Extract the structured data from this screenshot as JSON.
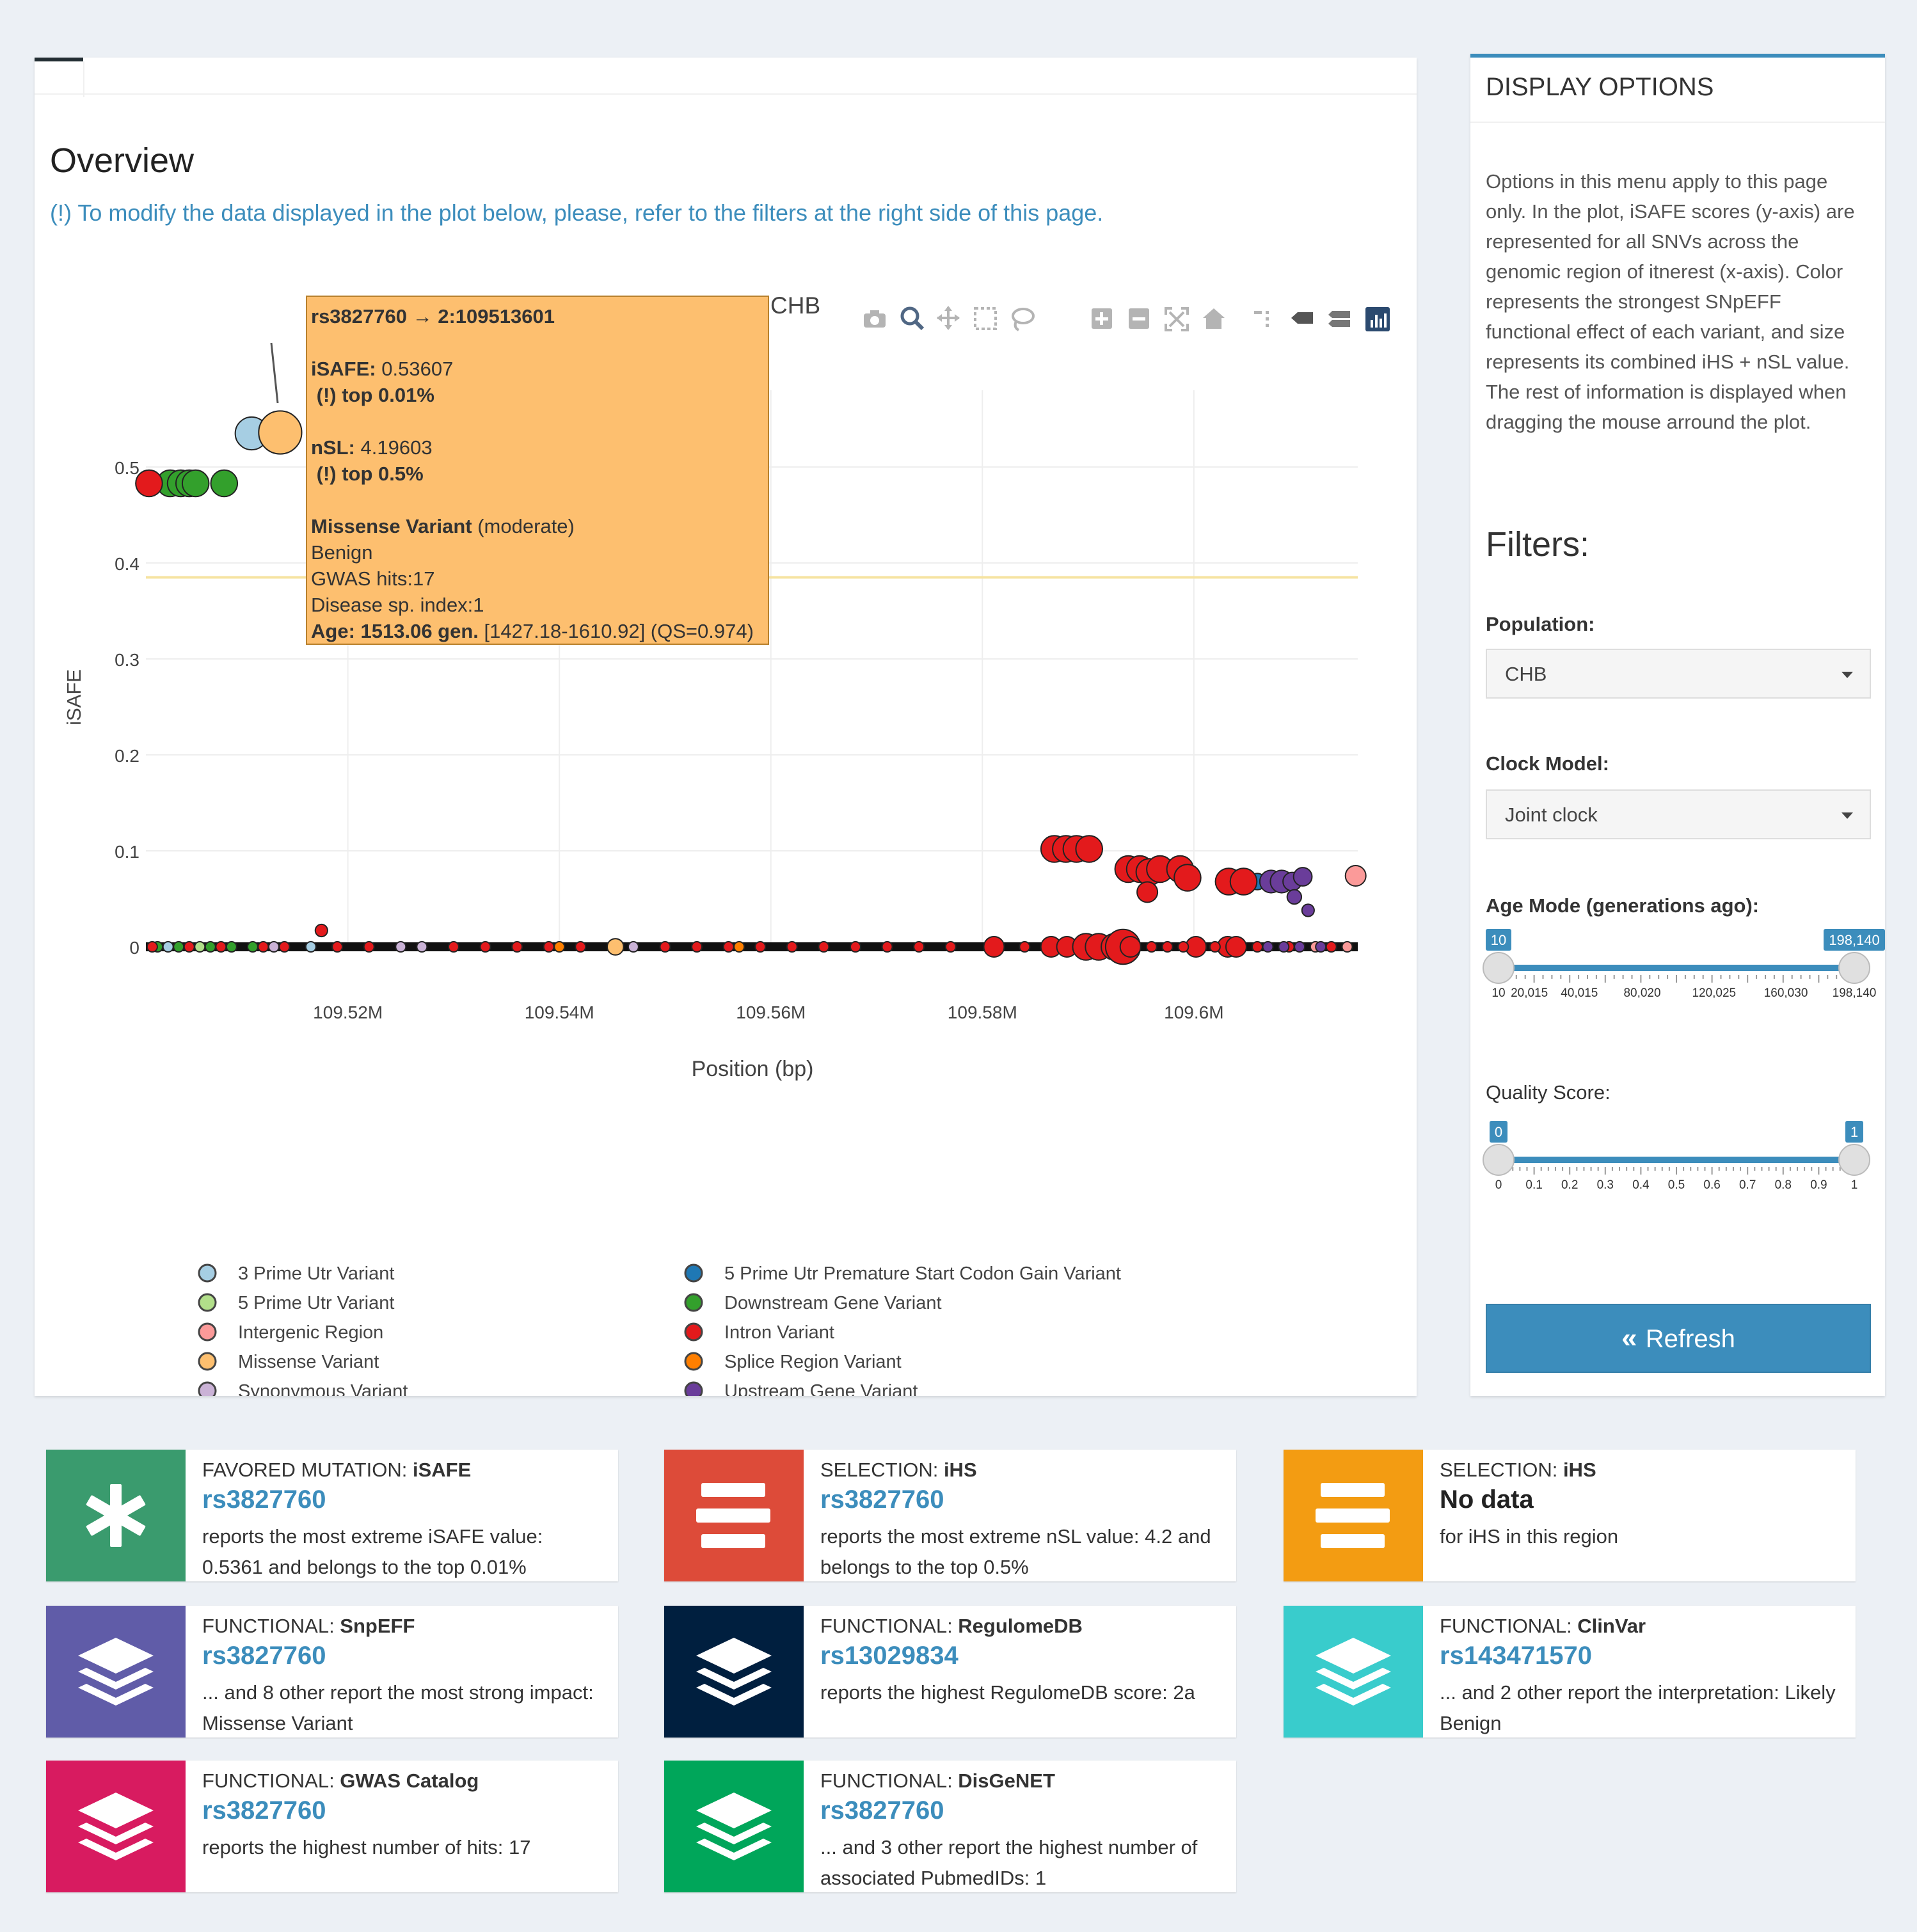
{
  "overview": {
    "title": "Overview",
    "note": "(!) To modify the data displayed in the plot below, please, refer to the filters at the right side of this page."
  },
  "plot": {
    "title_fragment": "CHB",
    "toolbar": [
      "camera-icon",
      "zoom-icon",
      "pan-icon",
      "box-select-icon",
      "lasso-select-icon",
      "zoom-in-icon",
      "zoom-out-icon",
      "autoscale-icon",
      "reset-axes-icon",
      "spike-lines-icon",
      "hover-closest-icon",
      "hover-compare-icon",
      "plotly-logo-icon"
    ],
    "tooltip": {
      "id_line": "rs3827760 → 2:109513601",
      "isafe_label": "iSAFE:",
      "isafe_value": "0.53607",
      "isafe_top": "(!) top 0.01%",
      "nsl_label": "nSL:",
      "nsl_value": "4.19603",
      "nsl_top": "(!) top 0.5%",
      "effect_label": "Missense Variant",
      "effect_impact": "(moderate)",
      "clinvar": "Benign",
      "gwas": "GWAS hits:17",
      "disease": "Disease sp. index:1",
      "age_label": "Age: 1513.06 gen.",
      "age_range": "[1427.18-1610.92] (QS=0.974)"
    }
  },
  "chart_data": {
    "type": "scatter",
    "title": "",
    "xlabel": "Position (bp)",
    "ylabel": "iSAFE",
    "xlim": [
      109500900,
      109615500
    ],
    "ylim": [
      0,
      0.58
    ],
    "x_ticks": [
      109520000,
      109540000,
      109560000,
      109580000,
      109600000
    ],
    "x_tick_labels": [
      "109.52M",
      "109.54M",
      "109.56M",
      "109.58M",
      "109.6M"
    ],
    "y_ticks": [
      0,
      0.1,
      0.2,
      0.3,
      0.4,
      0.5
    ],
    "y_tick_labels": [
      "0",
      "0.1",
      "0.2",
      "0.3",
      "0.4",
      "0.5"
    ],
    "threshold_line": 0.385,
    "grid": true,
    "legend_placement": "bottom",
    "series": [
      {
        "name": "3 Prime Utr Variant",
        "color": "#a6cee3",
        "points": [
          [
            109510900,
            0.535,
            3.2
          ],
          [
            109503000,
            0.0,
            1.0
          ],
          [
            109516500,
            0.0,
            1.0
          ]
        ]
      },
      {
        "name": "5 Prime Utr Variant",
        "color": "#b2df8a",
        "points": [
          [
            109506000,
            0.0,
            1.0
          ]
        ]
      },
      {
        "name": "Intergenic Region",
        "color": "#fb9a99",
        "points": [
          [
            109615300,
            0.074,
            2.0
          ],
          [
            109614500,
            0.0,
            1.0
          ],
          [
            109611500,
            0.0,
            1.0
          ]
        ]
      },
      {
        "name": "Missense Variant",
        "color": "#fdbf6f",
        "points": [
          [
            109513601,
            0.536,
            4.2
          ],
          [
            109545300,
            0.0,
            1.6
          ]
        ]
      },
      {
        "name": "Synonymous Variant",
        "color": "#cab2d6",
        "points": [
          [
            109513000,
            0.0,
            1.0
          ],
          [
            109525000,
            0.0,
            1.0
          ],
          [
            109527000,
            0.0,
            1.0
          ],
          [
            109547000,
            0.0,
            1.0
          ]
        ]
      },
      {
        "name": "5 Prime Utr Premature Start Codon Gain Variant",
        "color": "#1f78b4",
        "points": [
          [
            109606000,
            0.068,
            1.6
          ]
        ]
      },
      {
        "name": "Downstream Gene Variant",
        "color": "#33a02c",
        "points": [
          [
            109503200,
            0.483,
            2.6
          ],
          [
            109504200,
            0.483,
            2.6
          ],
          [
            109505000,
            0.483,
            2.6
          ],
          [
            109505600,
            0.483,
            2.6
          ],
          [
            109508300,
            0.483,
            2.6
          ],
          [
            109502000,
            0.0,
            1.0
          ],
          [
            109504000,
            0.0,
            1.0
          ],
          [
            109507000,
            0.0,
            1.0
          ],
          [
            109509000,
            0.0,
            1.0
          ],
          [
            109511000,
            0.0,
            1.0
          ]
        ]
      },
      {
        "name": "Intron Variant",
        "color": "#e31a1c",
        "points": [
          [
            109501200,
            0.483,
            2.6
          ],
          [
            109517500,
            0.017,
            1.2
          ],
          [
            109586800,
            0.102,
            2.6
          ],
          [
            109587900,
            0.102,
            2.6
          ],
          [
            109588900,
            0.102,
            2.6
          ],
          [
            109590100,
            0.102,
            2.6
          ],
          [
            109593800,
            0.081,
            2.6
          ],
          [
            109594900,
            0.081,
            2.6
          ],
          [
            109595800,
            0.078,
            2.6
          ],
          [
            109596800,
            0.081,
            2.6
          ],
          [
            109598700,
            0.081,
            2.6
          ],
          [
            109599400,
            0.072,
            2.6
          ],
          [
            109595600,
            0.057,
            2.0
          ],
          [
            109603300,
            0.068,
            2.6
          ],
          [
            109604700,
            0.068,
            2.6
          ],
          [
            109581100,
            0.0,
            2.0
          ],
          [
            109586500,
            0.0,
            2.0
          ],
          [
            109588000,
            0.0,
            2.0
          ],
          [
            109589800,
            0.0,
            2.6
          ],
          [
            109591000,
            0.0,
            2.6
          ],
          [
            109592500,
            0.0,
            2.6
          ],
          [
            109593300,
            0.0,
            3.4
          ],
          [
            109594000,
            0.0,
            2.0
          ],
          [
            109600200,
            0.0,
            2.0
          ],
          [
            109603200,
            0.0,
            2.0
          ],
          [
            109604000,
            0.0,
            2.0
          ],
          [
            109501500,
            0.0,
            1.0
          ],
          [
            109505000,
            0.0,
            1.0
          ],
          [
            109508000,
            0.0,
            1.0
          ],
          [
            109512000,
            0.0,
            1.0
          ],
          [
            109514000,
            0.0,
            1.0
          ],
          [
            109519000,
            0.0,
            1.0
          ],
          [
            109522000,
            0.0,
            1.0
          ],
          [
            109530000,
            0.0,
            1.0
          ],
          [
            109533000,
            0.0,
            1.0
          ],
          [
            109536000,
            0.0,
            1.0
          ],
          [
            109539000,
            0.0,
            1.0
          ],
          [
            109542000,
            0.0,
            1.0
          ],
          [
            109550000,
            0.0,
            1.0
          ],
          [
            109553000,
            0.0,
            1.0
          ],
          [
            109556000,
            0.0,
            1.0
          ],
          [
            109559000,
            0.0,
            1.0
          ],
          [
            109562000,
            0.0,
            1.0
          ],
          [
            109565000,
            0.0,
            1.0
          ],
          [
            109568000,
            0.0,
            1.0
          ],
          [
            109571000,
            0.0,
            1.0
          ],
          [
            109574000,
            0.0,
            1.0
          ],
          [
            109577000,
            0.0,
            1.0
          ],
          [
            109584000,
            0.0,
            1.0
          ],
          [
            109596000,
            0.0,
            1.0
          ],
          [
            109597500,
            0.0,
            1.0
          ],
          [
            109599000,
            0.0,
            1.0
          ],
          [
            109602000,
            0.0,
            1.0
          ],
          [
            109606000,
            0.0,
            1.0
          ],
          [
            109609000,
            0.0,
            1.0
          ],
          [
            109613000,
            0.0,
            1.0
          ]
        ]
      },
      {
        "name": "Splice Region Variant",
        "color": "#ff7f00",
        "points": [
          [
            109540000,
            0.0,
            1.0
          ],
          [
            109557000,
            0.0,
            1.0
          ]
        ]
      },
      {
        "name": "Upstream Gene Variant",
        "color": "#6a3d9a",
        "points": [
          [
            109607300,
            0.068,
            2.2
          ],
          [
            109608300,
            0.068,
            2.2
          ],
          [
            109609300,
            0.068,
            1.8
          ],
          [
            109610300,
            0.073,
            1.8
          ],
          [
            109609500,
            0.052,
            1.4
          ],
          [
            109610800,
            0.038,
            1.2
          ],
          [
            109607000,
            0.0,
            1.0
          ],
          [
            109608500,
            0.0,
            1.0
          ],
          [
            109610000,
            0.0,
            1.0
          ],
          [
            109612000,
            0.0,
            1.0
          ]
        ]
      }
    ]
  },
  "sidebar": {
    "title": "DISPLAY OPTIONS",
    "description": "Options in this menu apply to this page only. In the plot, iSAFE scores (y-axis) are represented for all SNVs across the genomic region of itnerest (x-axis). Color represents the strongest SNpEFF functional effect of each variant, and size represents its combined iHS + nSL value. The rest of information is displayed when dragging the mouse arround the plot.",
    "filters_title": "Filters:",
    "population": {
      "label": "Population:",
      "value": "CHB"
    },
    "clock": {
      "label": "Clock Model:",
      "value": "Joint clock"
    },
    "age": {
      "label": "Age Mode (generations ago):",
      "min_value": 10,
      "max_value": 198140,
      "min_label": "10",
      "max_label": "198,140",
      "range": [
        10,
        198140
      ],
      "tick_labels": [
        "10",
        "20,015",
        "40,015",
        "80,020",
        "120,025",
        "160,030",
        "198,140"
      ],
      "tick_values": [
        10,
        20015,
        40015,
        80020,
        120025,
        160030,
        198140
      ]
    },
    "quality": {
      "label": "Quality Score:",
      "min_value": 0,
      "max_value": 1,
      "min_label": "0",
      "max_label": "1",
      "range": [
        0,
        1
      ],
      "tick_labels": [
        "0",
        "0.1",
        "0.2",
        "0.3",
        "0.4",
        "0.5",
        "0.6",
        "0.7",
        "0.8",
        "0.9",
        "1"
      ]
    },
    "refresh_label": "Refresh"
  },
  "info_boxes": [
    {
      "color": "#3a9b6e",
      "icon": "asterisk-icon",
      "label_prefix": "FAVORED MUTATION: ",
      "label_bold": "iSAFE",
      "number": "rs3827760",
      "description": "reports the most extreme iSAFE value: 0.5361 and belongs to the top 0.01%"
    },
    {
      "color": "#dd4b39",
      "icon": "bars-icon",
      "label_prefix": "SELECTION: ",
      "label_bold": "iHS",
      "number": "rs3827760",
      "description": "reports the most extreme nSL value: 4.2 and belongs to the top 0.5%"
    },
    {
      "color": "#f39c12",
      "icon": "bars-icon",
      "label_prefix": "SELECTION: ",
      "label_bold": "iHS",
      "number": "No data",
      "description": "for iHS in this region"
    },
    {
      "color": "#605ca8",
      "icon": "layers-icon",
      "label_prefix": "FUNCTIONAL: ",
      "label_bold": "SnpEFF",
      "number": "rs3827760",
      "description": "... and 8 other report the most strong impact: Missense Variant"
    },
    {
      "color": "#001f3f",
      "icon": "layers-icon",
      "label_prefix": "FUNCTIONAL: ",
      "label_bold": "RegulomeDB",
      "number": "rs13029834",
      "description": "reports the highest RegulomeDB score: 2a"
    },
    {
      "color": "#39cccc",
      "icon": "layers-icon",
      "label_prefix": "FUNCTIONAL: ",
      "label_bold": "ClinVar",
      "number": "rs143471570",
      "description": "... and 2 other report the interpretation: Likely Benign"
    },
    {
      "color": "#d81b60",
      "icon": "layers-icon",
      "label_prefix": "FUNCTIONAL: ",
      "label_bold": "GWAS Catalog",
      "number": "rs3827760",
      "description": "reports the highest number of hits: 17"
    },
    {
      "color": "#00a65a",
      "icon": "layers-icon",
      "label_prefix": "FUNCTIONAL: ",
      "label_bold": "DisGeNET",
      "number": "rs3827760",
      "description": "... and 3 other report the highest number of associated PubmedIDs: 1"
    }
  ]
}
